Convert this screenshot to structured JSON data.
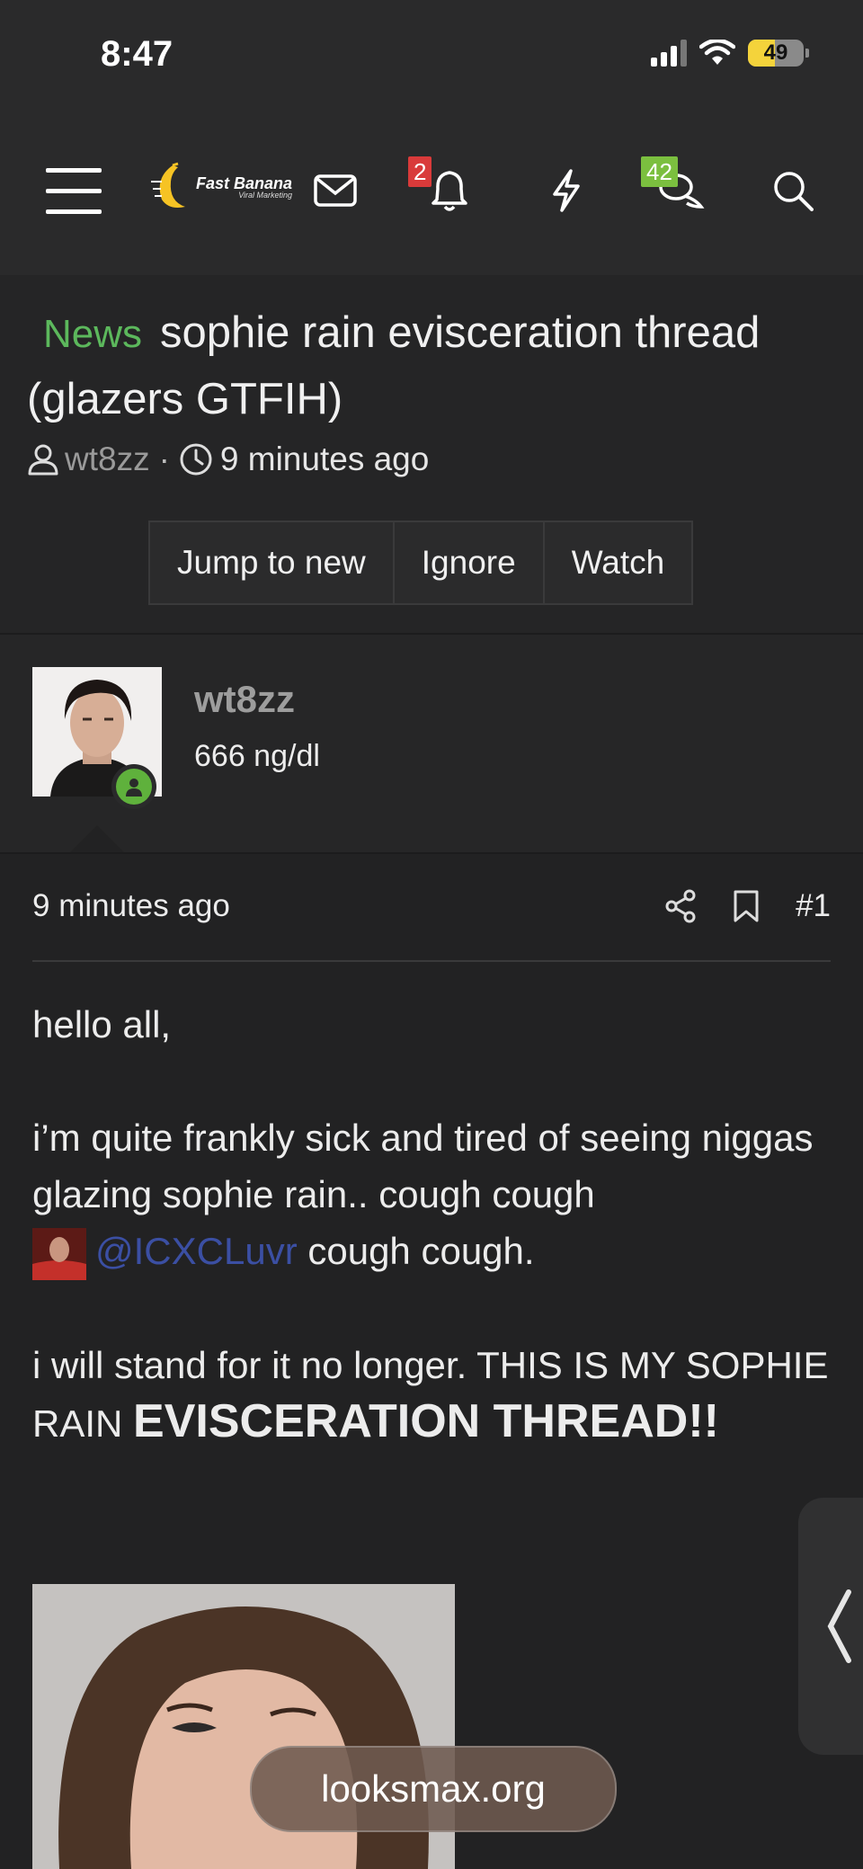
{
  "status_bar": {
    "time": "8:47",
    "battery": "49",
    "battery_level": 0.49
  },
  "nav": {
    "logo": {
      "name": "Fast Banana",
      "tagline": "Viral Marketing"
    },
    "alerts_badge": "2",
    "conversations_badge": "42",
    "icons": [
      "menu-icon",
      "mail-icon",
      "bell-icon",
      "bolt-icon",
      "chat-icon",
      "search-icon"
    ]
  },
  "thread": {
    "prefix": "News",
    "title": "sophie rain evisceration thread (glazers GTFIH)",
    "author": "wt8zz",
    "time": "9 minutes ago",
    "buttons": {
      "jump": "Jump to new",
      "ignore": "Ignore",
      "watch": "Watch"
    }
  },
  "post": {
    "username": "wt8zz",
    "user_title": "666 ng/dl",
    "time": "9 minutes ago",
    "number": "#1",
    "p1": "hello all,",
    "p2_a": "i’m quite frankly sick and tired of seeing niggas glazing sophie rain.. cough cough",
    "mention": "@ICXCLuvr",
    "p2_b": "cough cough.",
    "p3_a": "i will stand for it no longer. THIS IS MY SOPHIE RAIN",
    "p3_b": "EVISCERATION THREAD!!"
  },
  "browser": {
    "url": "looksmax.org"
  },
  "colors": {
    "accent_green": "#5cb85c",
    "mention_blue": "#3b4fa3",
    "badge_red": "#d93a3a",
    "badge_green": "#7bbf3f"
  }
}
